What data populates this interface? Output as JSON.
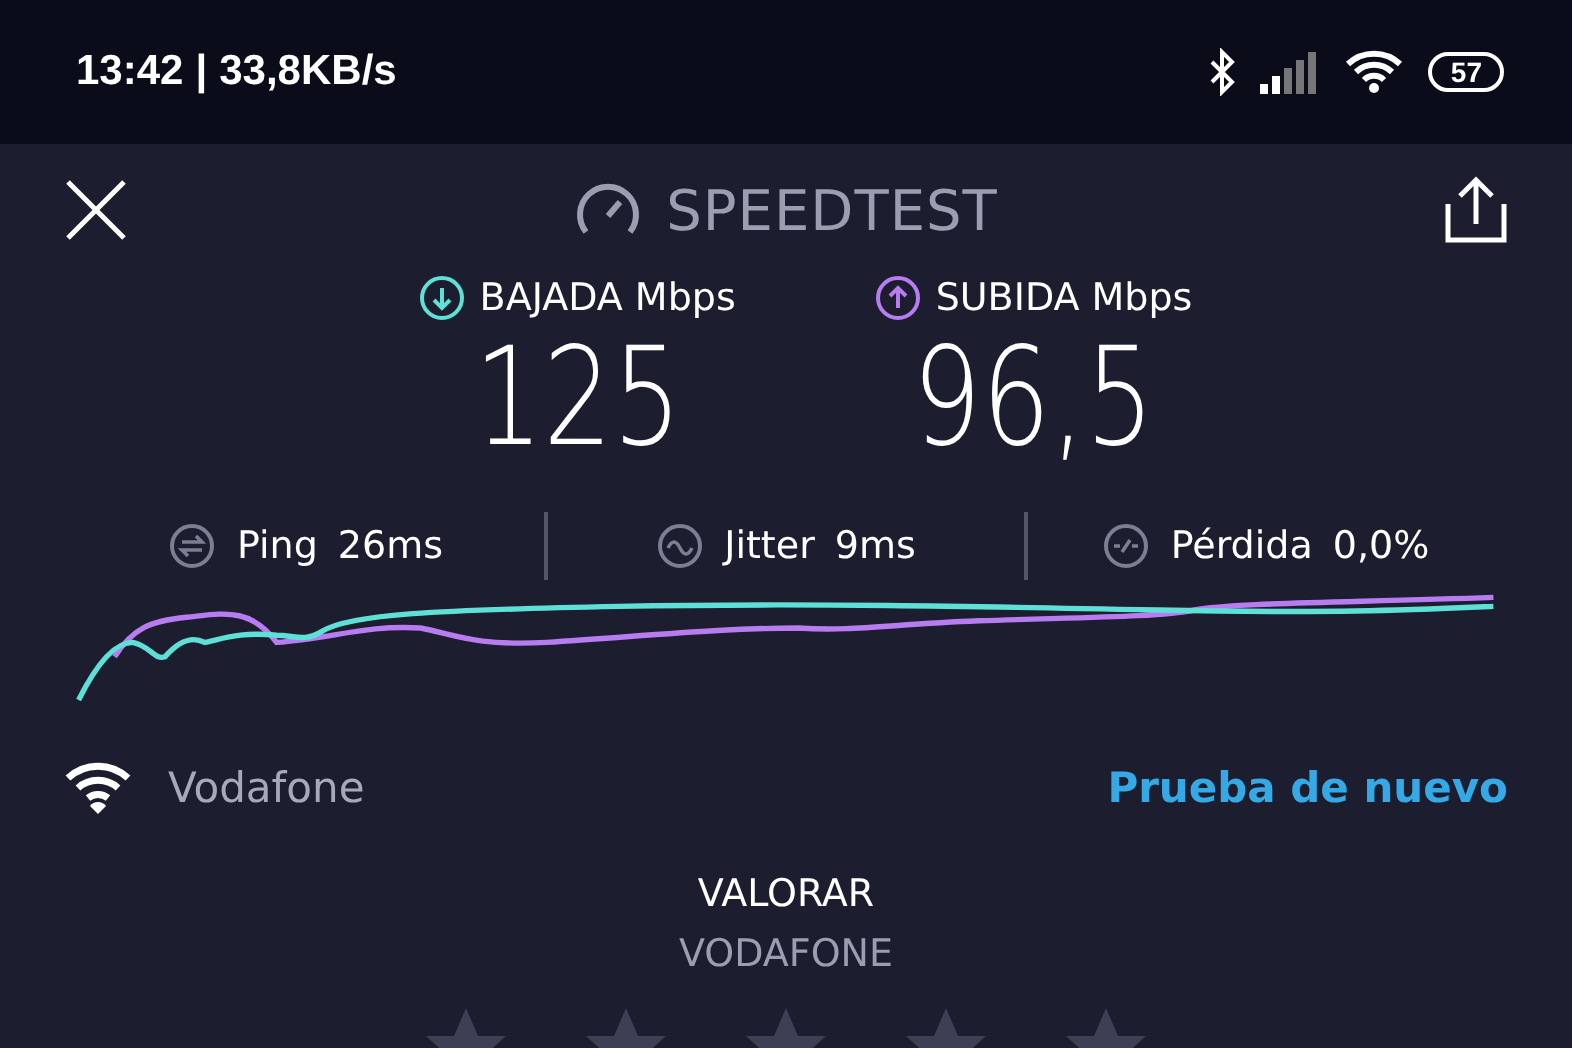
{
  "status_bar": {
    "time": "13:42",
    "separator": "|",
    "speed": "33,8KB/s",
    "battery": "57"
  },
  "header": {
    "title": "SPEEDTEST"
  },
  "results": [
    {
      "kind": "download",
      "label": "BAJADA Mbps",
      "value": "125",
      "color": "#5ee0d6"
    },
    {
      "kind": "upload",
      "label": "SUBIDA Mbps",
      "value": "96,5",
      "color": "#b77cf0"
    }
  ],
  "stats": [
    {
      "kind": "ping",
      "label": "Ping",
      "value": "26ms"
    },
    {
      "kind": "jitter",
      "label": "Jitter",
      "value": "9ms"
    },
    {
      "kind": "loss",
      "label": "Pérdida",
      "value": "0,0%"
    }
  ],
  "network": {
    "name": "Vodafone",
    "retry": "Prueba de nuevo"
  },
  "rating": {
    "title": "VALORAR",
    "provider": "VODAFONE",
    "stars": 0
  }
}
